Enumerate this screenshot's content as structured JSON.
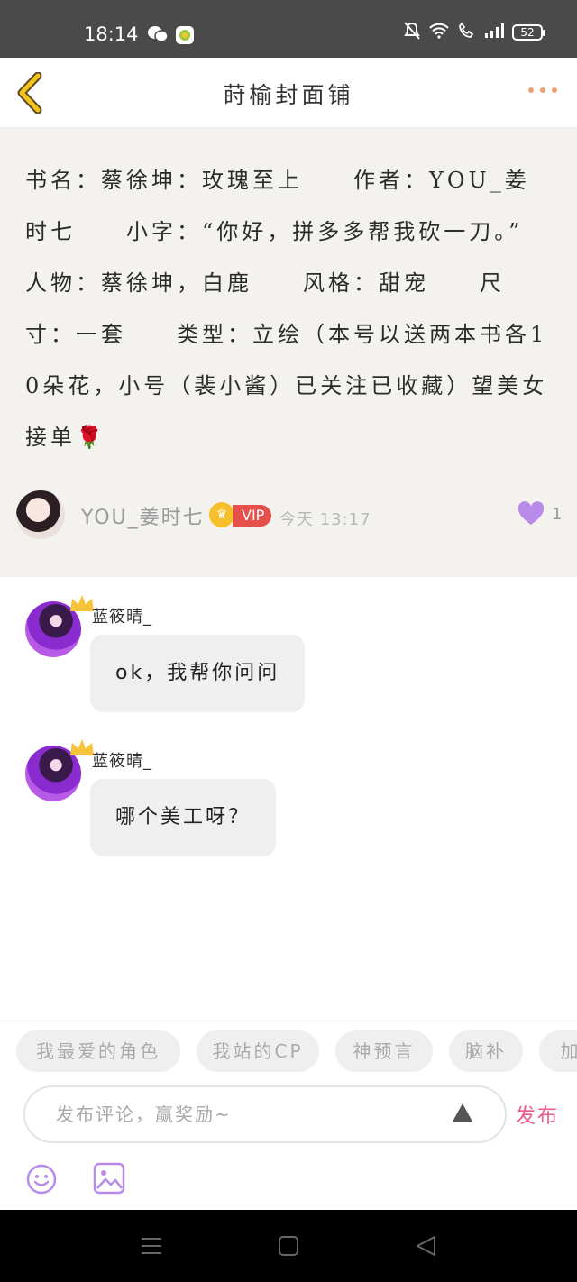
{
  "status_bar": {
    "time": "18:14",
    "battery": "52",
    "icons": [
      "wechat-icon",
      "app-notification-icon",
      "mute-icon",
      "wifi-icon",
      "call-icon",
      "signal-icon",
      "battery-icon"
    ]
  },
  "header": {
    "title": "莳榆封面铺",
    "back_icon": "chevron-left-icon",
    "more_icon": "more-dots-icon"
  },
  "post": {
    "body": "书名：蔡徐坤：玫瑰至上　　作者：YOU_姜时七　　小字：“你好，拼多多帮我砍一刀。”　　人物：蔡徐坤，白鹿　　风格：甜宠　　尺寸：一套　　类型：立绘（本号以送两本书各10朵花，小号（裴小酱）已关注已收藏）望美女接单🌹",
    "author": "YOU_姜时七",
    "vip_label": "VIP",
    "time": "今天 13:17",
    "like_count": "1"
  },
  "comments": [
    {
      "name": "蓝筱晴_",
      "text": "ok，我帮你问问"
    },
    {
      "name": "蓝筱晴_",
      "text": "哪个美工呀？"
    }
  ],
  "chips": [
    "我最爱的角色",
    "我站的CP",
    "神预言",
    "脑补",
    "加"
  ],
  "composer": {
    "placeholder": "发布评论，赢奖励~",
    "publish_label": "发布"
  },
  "colors": {
    "accent_pink": "#ee5a8a",
    "like_purple": "#b98be8",
    "vip_red": "#e6504a",
    "back_yellow": "#f2c318"
  }
}
